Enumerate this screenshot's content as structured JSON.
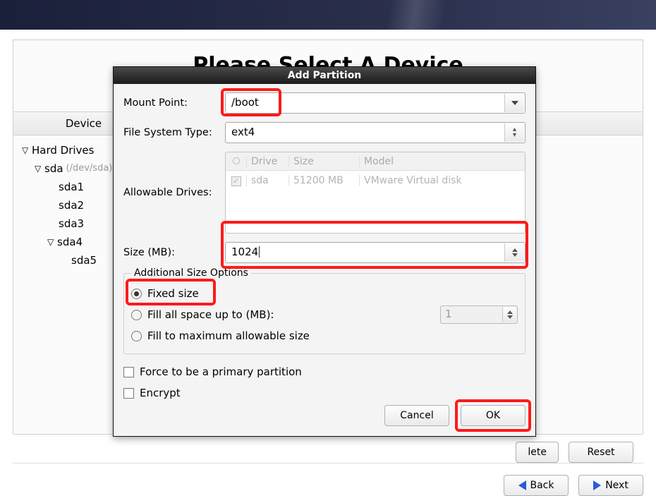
{
  "main": {
    "title": "Please Select A Device",
    "device_header": "Device",
    "tree": [
      {
        "label": "Hard Drives",
        "expanded": true,
        "depth": 0
      },
      {
        "label": "sda",
        "hint": "(/dev/sda)",
        "expanded": true,
        "depth": 1
      },
      {
        "label": "sda1",
        "depth": 2
      },
      {
        "label": "sda2",
        "depth": 2
      },
      {
        "label": "sda3",
        "depth": 2
      },
      {
        "label": "sda4",
        "expanded": true,
        "depth": 2
      },
      {
        "label": "sda5",
        "depth": 3
      }
    ]
  },
  "buttons": {
    "delete": "lete",
    "reset": "Reset",
    "back": "Back",
    "next": "Next"
  },
  "dialog": {
    "title": "Add Partition",
    "mount_label": "Mount Point:",
    "mount_value": "/boot",
    "fs_label": "File System Type:",
    "fs_value": "ext4",
    "drives_label": "Allowable Drives:",
    "drives_cols": {
      "drive": "Drive",
      "size": "Size",
      "model": "Model"
    },
    "drive_row": {
      "name": "sda",
      "size": "51200 MB",
      "model": "VMware Virtual disk",
      "checked": true
    },
    "size_label": "Size (MB):",
    "size_value": "1024",
    "opts_legend": "Additional Size Options",
    "opt_fixed": "Fixed size",
    "opt_fill_to": "Fill all space up to (MB):",
    "opt_fill_to_value": "1",
    "opt_fill_max": "Fill to maximum allowable size",
    "force_primary": "Force to be a primary partition",
    "encrypt": "Encrypt",
    "cancel": "Cancel",
    "ok": "OK"
  }
}
